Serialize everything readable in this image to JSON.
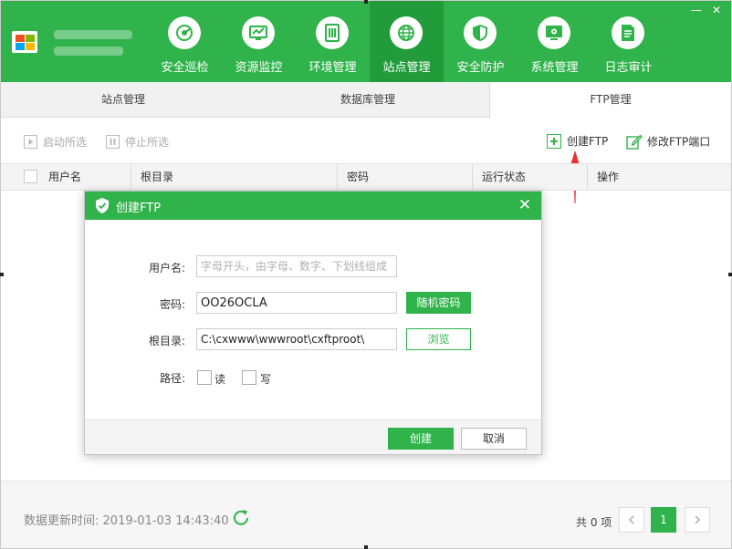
{
  "nav": {
    "items": [
      {
        "label": "安全巡检",
        "icon": "radar-icon"
      },
      {
        "label": "资源监控",
        "icon": "monitor-chart-icon"
      },
      {
        "label": "环境管理",
        "icon": "server-icon"
      },
      {
        "label": "站点管理",
        "icon": "globe-icon"
      },
      {
        "label": "安全防护",
        "icon": "shield-icon"
      },
      {
        "label": "系统管理",
        "icon": "system-monitor-icon"
      },
      {
        "label": "日志审计",
        "icon": "document-icon"
      }
    ],
    "active": "站点管理"
  },
  "window": {
    "minimize": "—",
    "close": "✕"
  },
  "tabs": [
    {
      "label": "站点管理"
    },
    {
      "label": "数据库管理"
    },
    {
      "label": "FTP管理"
    }
  ],
  "active_tab": "FTP管理",
  "toolbar": {
    "start_selected": "启动所选",
    "stop_selected": "停止所选",
    "create_ftp": "创建FTP",
    "modify_port": "修改FTP端口"
  },
  "table": {
    "columns": [
      "用户名",
      "根目录",
      "密码",
      "运行状态",
      "操作"
    ],
    "rows": []
  },
  "footer": {
    "update_label": "数据更新时间:",
    "update_time": "2019-01-03 14:43:40",
    "total": "共 0 项",
    "current_page": "1"
  },
  "dialog": {
    "title": "创建FTP",
    "username_label": "用户名:",
    "username_placeholder": "字母开头，由字母、数字、下划线组成",
    "password_label": "密码:",
    "password_value": "OO26OCLA",
    "random_password": "随机密码",
    "root_label": "根目录:",
    "root_value": "C:\\cxwww\\wwwroot\\cxftproot\\",
    "browse": "浏览",
    "path_label": "路径:",
    "read_label": "读",
    "write_label": "写",
    "confirm": "创建",
    "cancel": "取消"
  },
  "colors": {
    "brand": "#2fb34a",
    "brand_dark": "#229c3b",
    "annotation_arrow": "#e8332f"
  }
}
